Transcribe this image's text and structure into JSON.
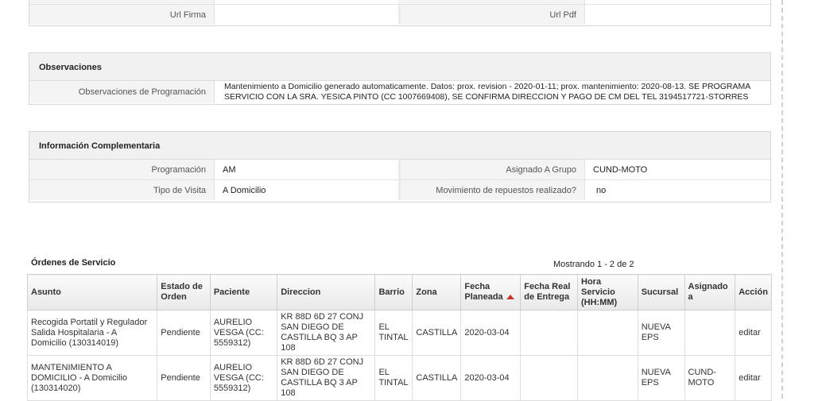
{
  "top_panel": {
    "url_firma_label": "Url Firma",
    "url_firma_value": "",
    "url_pdf_label": "Url Pdf",
    "url_pdf_value": ""
  },
  "observaciones": {
    "title": "Observaciones",
    "label": "Observaciones de Programación",
    "value": "Mantenimiento a Domicilio generado automaticamente. Datos: prox. revision - 2020-01-11; prox. mantenimiento: 2020-08-13. SE PROGRAMA SERVICIO CON LA SRA. YESICA PINTO (CC 1007669408), SE CONFIRMA DIRECCION Y PAGO DE CM DEL TEL 3194517721-STORRES"
  },
  "complementaria": {
    "title": "Información Complementaria",
    "programacion_label": "Programación",
    "programacion_value": "AM",
    "grupo_label": "Asignado A Grupo",
    "grupo_value": "CUND-MOTO",
    "visita_label": "Tipo de Visita",
    "visita_value": "A Domicilio",
    "repuestos_label": "Movimiento de repuestos realizado?",
    "repuestos_value": "no"
  },
  "orders": {
    "title": "Órdenes de Servicio",
    "count_text": "Mostrando 1 - 2 de 2",
    "headers": {
      "asunto": "Asunto",
      "estado": "Estado de Orden",
      "paciente": "Paciente",
      "direccion": "Direccion",
      "barrio": "Barrio",
      "zona": "Zona",
      "fecha_planeada": "Fecha Planeada",
      "fecha_real": "Fecha Real de Entrega",
      "hora": "Hora Servicio (HH:MM)",
      "sucursal": "Sucursal",
      "asignado": "Asignado a",
      "accion": "Acción"
    },
    "rows": [
      {
        "asunto": "Recogida Portatil y Regulador Salida Hospitalaria - A Domicilio (130314019)",
        "estado": "Pendiente",
        "paciente": "AURELIO VESGA (CC: 5559312)",
        "direccion": "KR 88D 6D 27 CONJ SAN DIEGO DE CASTILLA BQ 3 AP 108",
        "barrio": "EL TINTAL",
        "zona": "CASTILLA",
        "fecha_planeada": "2020-03-04",
        "fecha_real": "",
        "hora": "",
        "sucursal": "NUEVA EPS",
        "asignado": "",
        "accion": "editar"
      },
      {
        "asunto": "MANTENIMIENTO A DOMICILIO - A Domicilio (130314020)",
        "estado": "Pendiente",
        "paciente": "AURELIO VESGA (CC: 5559312)",
        "direccion": "KR 88D 6D 27 CONJ SAN DIEGO DE CASTILLA BQ 3 AP 108",
        "barrio": "EL TINTAL",
        "zona": "CASTILLA",
        "fecha_planeada": "2020-03-04",
        "fecha_real": "",
        "hora": "",
        "sucursal": "NUEVA EPS",
        "asignado": "CUND-MOTO",
        "accion": "editar"
      }
    ]
  }
}
